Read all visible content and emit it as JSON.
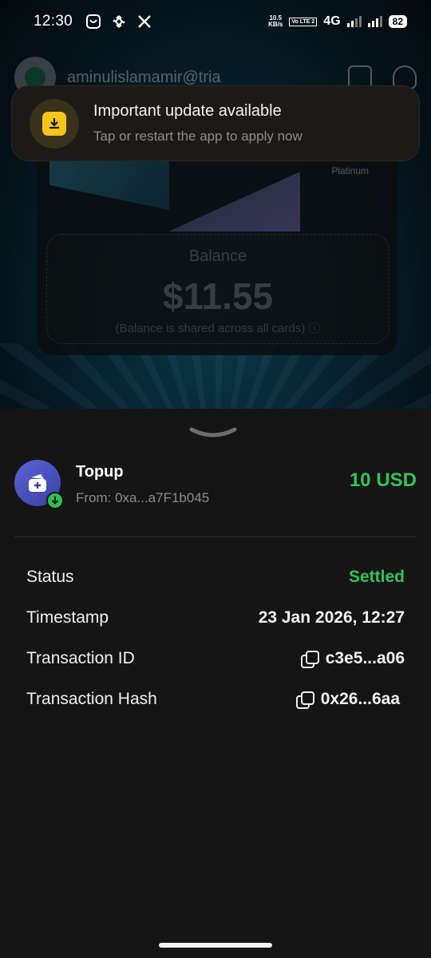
{
  "status_bar": {
    "time": "12:30",
    "netspeed_value": "10.5",
    "netspeed_unit": "KB/s",
    "volte": "Vo LTE 2",
    "network": "4G",
    "battery": "82",
    "icons": [
      "tria-app-icon",
      "binance-icon",
      "x-icon"
    ]
  },
  "background": {
    "user_email": "aminulislamamir@tria",
    "card_tier": "Platinum",
    "balance_label": "Balance",
    "balance_value": "$11.55",
    "balance_note": "(Balance is shared across all cards) ⓘ"
  },
  "toast": {
    "title": "Important update available",
    "subtitle": "Tap or restart the app to apply now",
    "accent": "#f5c518"
  },
  "transaction": {
    "title": "Topup",
    "from": "From: 0xa...a7F1b045",
    "amount": "10 USD",
    "amount_color": "#35c35a"
  },
  "details": [
    {
      "label": "Status",
      "value": "Settled",
      "copy": false
    },
    {
      "label": "Timestamp",
      "value": "23 Jan 2026, 12:27",
      "copy": false
    },
    {
      "label": "Transaction ID",
      "value": "c3e5...a06",
      "copy": true
    },
    {
      "label": "Transaction Hash",
      "value": "0x26...6aa",
      "copy": true
    }
  ]
}
